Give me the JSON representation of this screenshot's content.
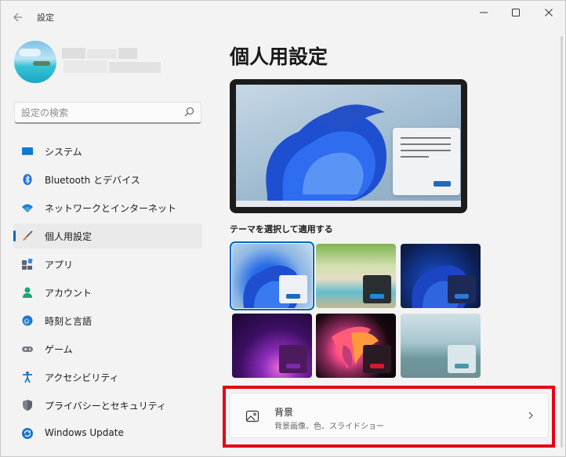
{
  "window": {
    "app_title": "設定",
    "back_icon": "back-arrow-icon",
    "controls": [
      "minimize-icon",
      "maximize-icon",
      "close-icon"
    ]
  },
  "search": {
    "placeholder": "設定の検索",
    "value": ""
  },
  "sidebar": {
    "items": [
      {
        "label": "システム",
        "icon": "display-icon",
        "selected": false
      },
      {
        "label": "Bluetooth とデバイス",
        "icon": "bluetooth-icon",
        "selected": false
      },
      {
        "label": "ネットワークとインターネット",
        "icon": "wifi-icon",
        "selected": false
      },
      {
        "label": "個人用設定",
        "icon": "brush-icon",
        "selected": true
      },
      {
        "label": "アプリ",
        "icon": "apps-icon",
        "selected": false
      },
      {
        "label": "アカウント",
        "icon": "person-icon",
        "selected": false
      },
      {
        "label": "時刻と言語",
        "icon": "clock-globe-icon",
        "selected": false
      },
      {
        "label": "ゲーム",
        "icon": "gamepad-icon",
        "selected": false
      },
      {
        "label": "アクセシビリティ",
        "icon": "accessibility-icon",
        "selected": false
      },
      {
        "label": "プライバシーとセキュリティ",
        "icon": "shield-icon",
        "selected": false
      },
      {
        "label": "Windows Update",
        "icon": "update-icon",
        "selected": false
      }
    ]
  },
  "main": {
    "title": "個人用設定",
    "theme_section_label": "テーマを選択して適用する",
    "themes": [
      {
        "name": "windows-light",
        "selected": true
      },
      {
        "name": "glow-beach",
        "selected": false
      },
      {
        "name": "windows-dark",
        "selected": false
      },
      {
        "name": "captured-motion",
        "selected": false
      },
      {
        "name": "flow",
        "selected": false
      },
      {
        "name": "sunrise",
        "selected": false
      }
    ],
    "background_setting": {
      "title": "背景",
      "description": "背景画像、色、スライドショー",
      "icon": "image-icon"
    }
  },
  "colors": {
    "accent": "#0067c0",
    "highlight_box": "#e60012",
    "window_bg": "#f3f3f3"
  }
}
